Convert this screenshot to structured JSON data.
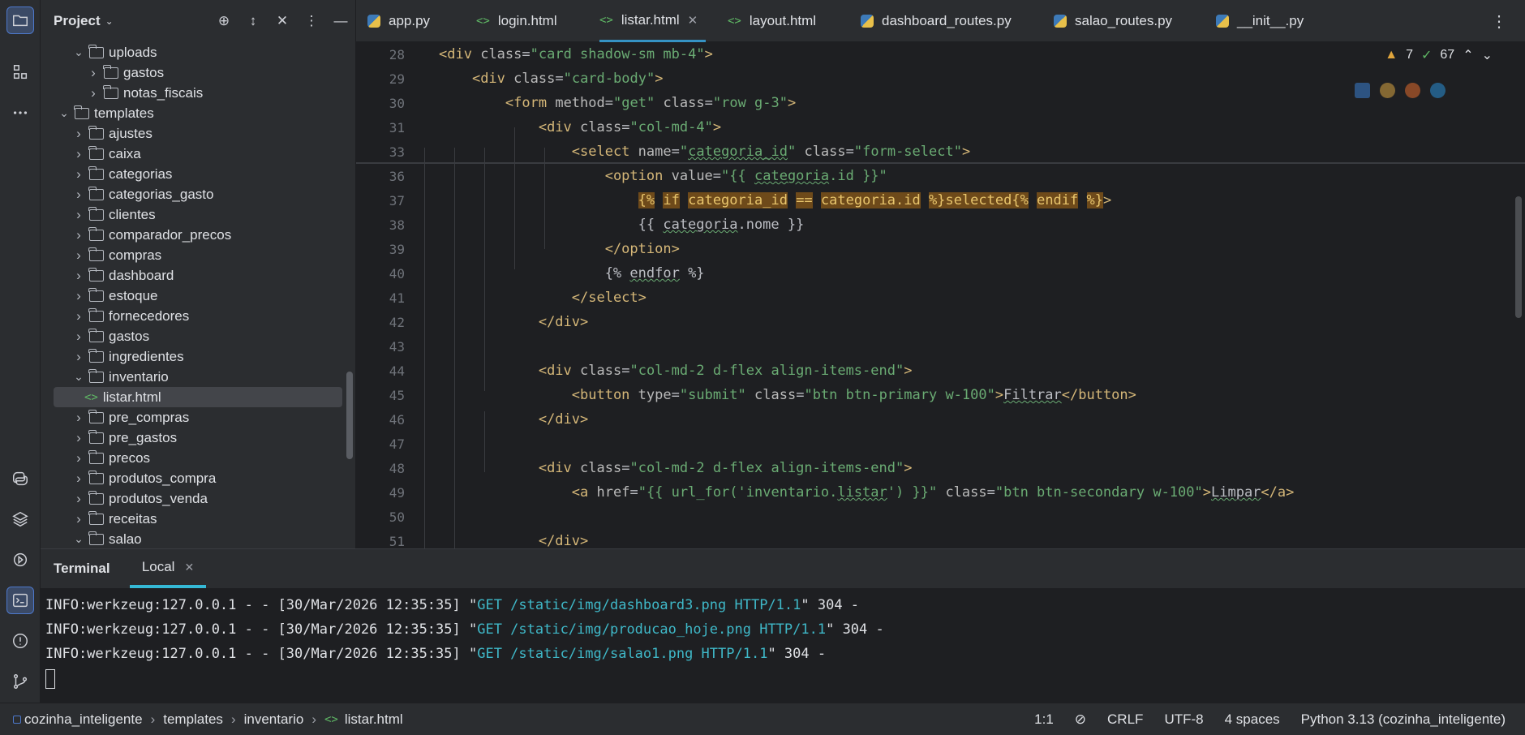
{
  "project": {
    "title": "Project",
    "tree": [
      {
        "label": "uploads",
        "kind": "folder",
        "expanded": true,
        "depth": 2
      },
      {
        "label": "gastos",
        "kind": "folder",
        "expanded": false,
        "depth": 3
      },
      {
        "label": "notas_fiscais",
        "kind": "folder",
        "expanded": false,
        "depth": 3
      },
      {
        "label": "templates",
        "kind": "folder",
        "expanded": true,
        "depth": 1
      },
      {
        "label": "ajustes",
        "kind": "folder",
        "expanded": false,
        "depth": 2
      },
      {
        "label": "caixa",
        "kind": "folder",
        "expanded": false,
        "depth": 2
      },
      {
        "label": "categorias",
        "kind": "folder",
        "expanded": false,
        "depth": 2
      },
      {
        "label": "categorias_gasto",
        "kind": "folder",
        "expanded": false,
        "depth": 2
      },
      {
        "label": "clientes",
        "kind": "folder",
        "expanded": false,
        "depth": 2
      },
      {
        "label": "comparador_precos",
        "kind": "folder",
        "expanded": false,
        "depth": 2
      },
      {
        "label": "compras",
        "kind": "folder",
        "expanded": false,
        "depth": 2
      },
      {
        "label": "dashboard",
        "kind": "folder",
        "expanded": false,
        "depth": 2
      },
      {
        "label": "estoque",
        "kind": "folder",
        "expanded": false,
        "depth": 2
      },
      {
        "label": "fornecedores",
        "kind": "folder",
        "expanded": false,
        "depth": 2
      },
      {
        "label": "gastos",
        "kind": "folder",
        "expanded": false,
        "depth": 2
      },
      {
        "label": "ingredientes",
        "kind": "folder",
        "expanded": false,
        "depth": 2
      },
      {
        "label": "inventario",
        "kind": "folder",
        "expanded": true,
        "depth": 2
      },
      {
        "label": "listar.html",
        "kind": "html",
        "selected": true,
        "depth": 3
      },
      {
        "label": "pre_compras",
        "kind": "folder",
        "expanded": false,
        "depth": 2
      },
      {
        "label": "pre_gastos",
        "kind": "folder",
        "expanded": false,
        "depth": 2
      },
      {
        "label": "precos",
        "kind": "folder",
        "expanded": false,
        "depth": 2
      },
      {
        "label": "produtos_compra",
        "kind": "folder",
        "expanded": false,
        "depth": 2
      },
      {
        "label": "produtos_venda",
        "kind": "folder",
        "expanded": false,
        "depth": 2
      },
      {
        "label": "receitas",
        "kind": "folder",
        "expanded": false,
        "depth": 2
      },
      {
        "label": "salao",
        "kind": "folder",
        "expanded": true,
        "depth": 2
      }
    ]
  },
  "tabs": [
    {
      "label": "app.py",
      "type": "py"
    },
    {
      "label": "login.html",
      "type": "html"
    },
    {
      "label": "listar.html",
      "type": "html",
      "active": true
    },
    {
      "label": "layout.html",
      "type": "html"
    },
    {
      "label": "dashboard_routes.py",
      "type": "py"
    },
    {
      "label": "salao_routes.py",
      "type": "py"
    },
    {
      "label": "__init__.py",
      "type": "py"
    }
  ],
  "inspections": {
    "warnings": "7",
    "ok": "67"
  },
  "editor_lines": {
    "l28": "28",
    "l29": "29",
    "l30": "30",
    "l31": "31",
    "l33": "33",
    "l36": "36",
    "l37": "37",
    "l38": "38",
    "l39": "39",
    "l40": "40",
    "l41": "41",
    "l42": "42",
    "l43": "43",
    "l44": "44",
    "l45": "45",
    "l46": "46",
    "l47": "47",
    "l48": "48",
    "l49": "49",
    "l50": "50",
    "l51": "51"
  },
  "terminal": {
    "title": "Terminal",
    "tab": "Local",
    "lines": [
      {
        "prefix": "INFO:werkzeug:127.0.0.1 - - [30/Mar/2026 12:35:35] \"",
        "request": "GET /static/img/dashboard3.png HTTP/1.1",
        "suffix": "\" 304 -"
      },
      {
        "prefix": "INFO:werkzeug:127.0.0.1 - - [30/Mar/2026 12:35:35] \"",
        "request": "GET /static/img/producao_hoje.png HTTP/1.1",
        "suffix": "\" 304 -"
      },
      {
        "prefix": "INFO:werkzeug:127.0.0.1 - - [30/Mar/2026 12:35:35] \"",
        "request": "GET /static/img/salao1.png HTTP/1.1",
        "suffix": "\" 304 -"
      }
    ]
  },
  "statusbar": {
    "breadcrumbs": [
      "cozinha_inteligente",
      "templates",
      "inventario",
      "listar.html"
    ],
    "position": "1:1",
    "line_sep": "CRLF",
    "encoding": "UTF-8",
    "indent": "4 spaces",
    "interpreter": "Python 3.13 (cozinha_inteligente)"
  }
}
